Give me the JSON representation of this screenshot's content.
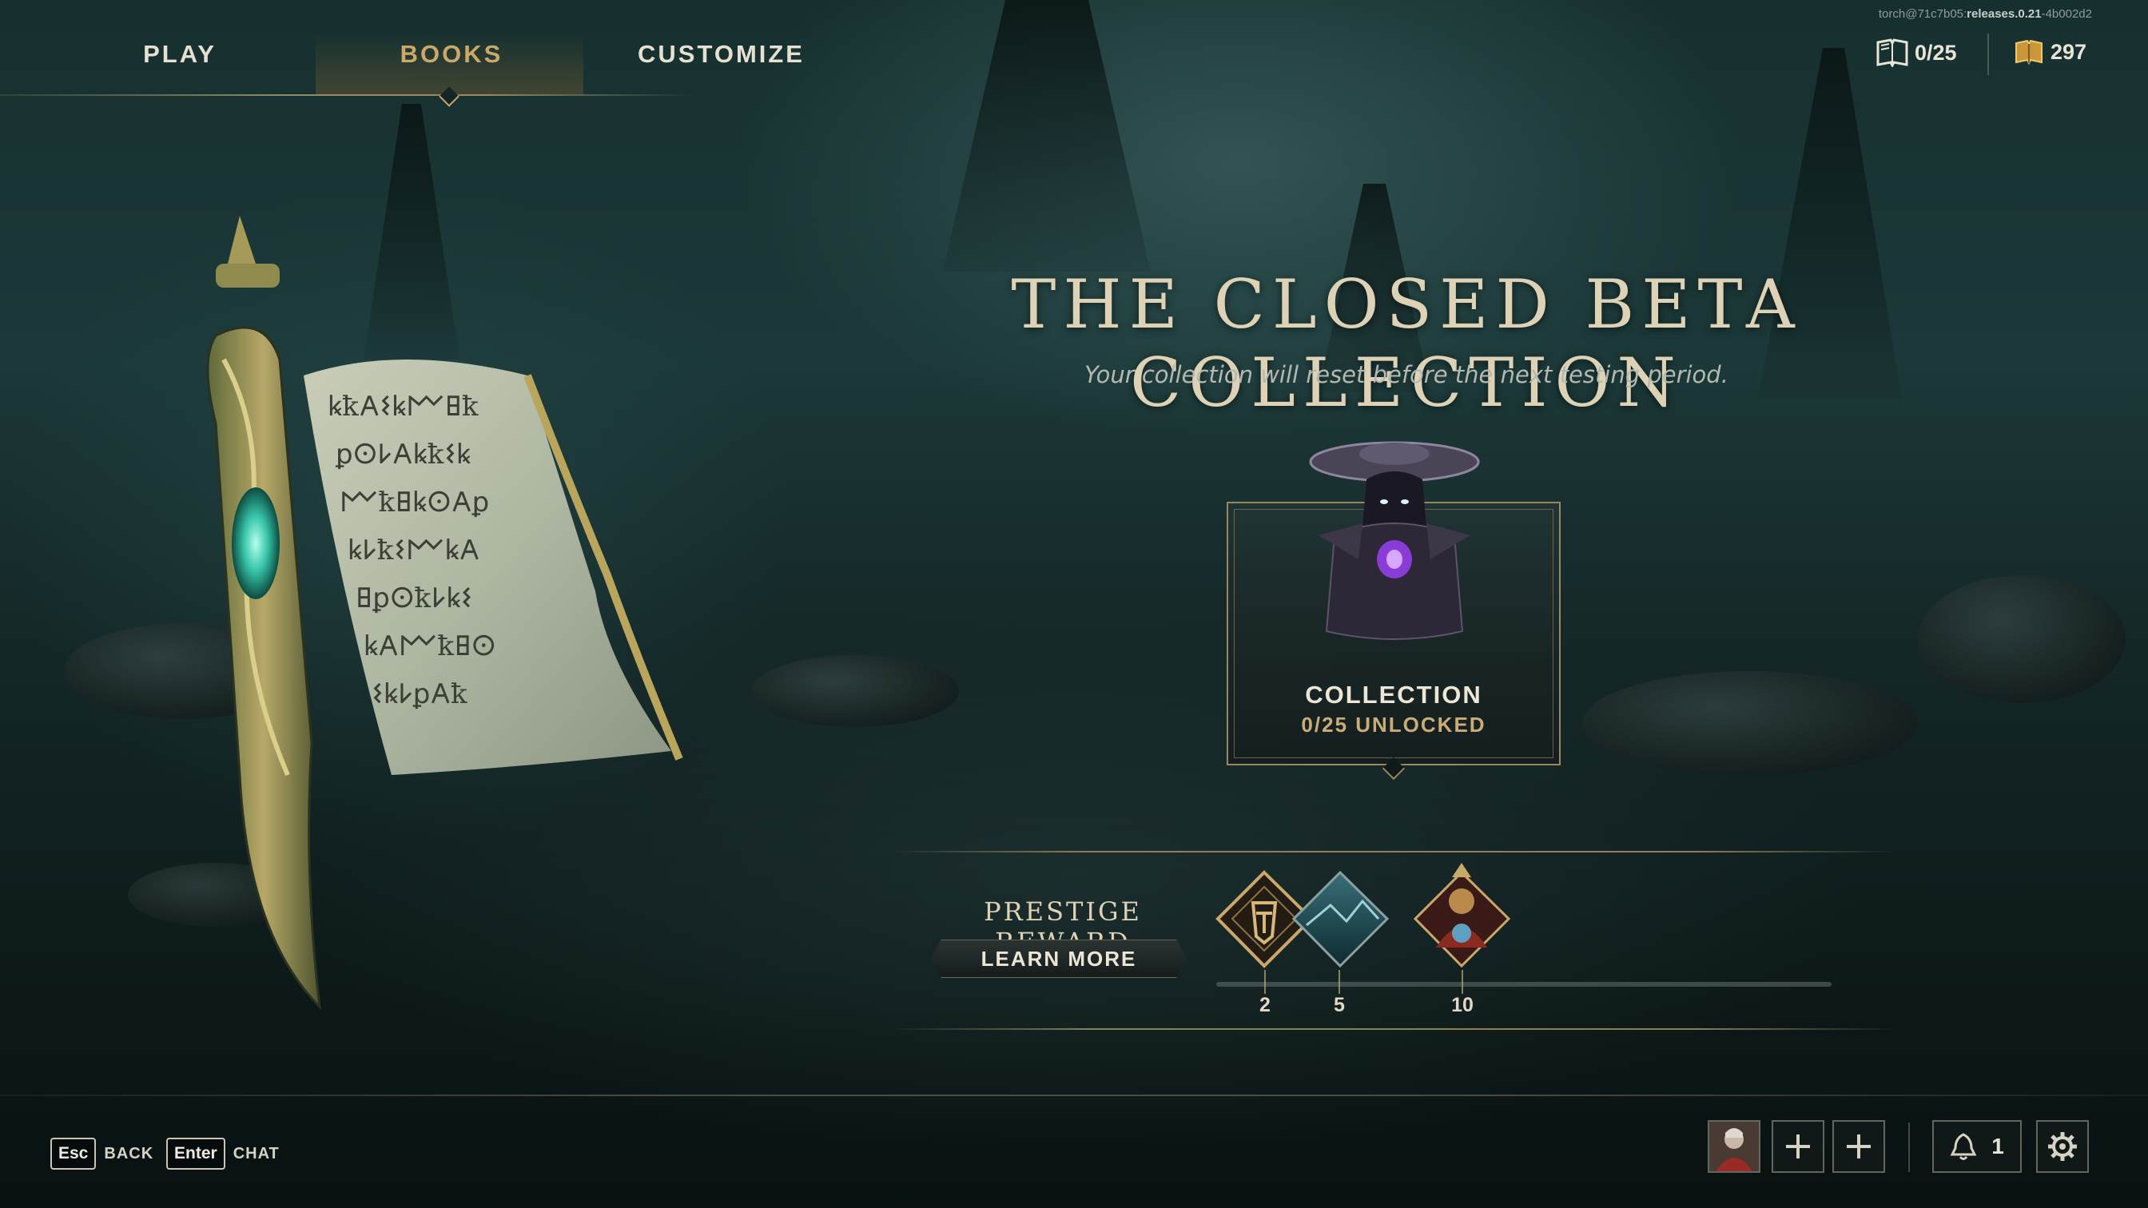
{
  "build": {
    "prefix": "torch@71c7b05:",
    "release": "releases.0.21",
    "suffix": "-4b002d2"
  },
  "nav": {
    "tabs": [
      {
        "label": "PLAY",
        "active": false
      },
      {
        "label": "BOOKS",
        "active": true
      },
      {
        "label": "CUSTOMIZE",
        "active": false
      }
    ]
  },
  "currency": {
    "books": {
      "icon": "book-icon",
      "value": "0/25"
    },
    "gold": {
      "icon": "gold-icon",
      "value": "297"
    }
  },
  "main": {
    "title": "THE CLOSED BETA COLLECTION",
    "subtitle": "Your collection will reset before the next testing period."
  },
  "collection_card": {
    "title": "COLLECTION",
    "status": "0/25 UNLOCKED"
  },
  "prestige": {
    "label": "PRESTIGE REWARD",
    "button": "LEARN MORE",
    "tiers": [
      {
        "value": "2",
        "icon": "emblem-icon"
      },
      {
        "value": "5",
        "icon": "landscape-banner-icon"
      },
      {
        "value": "10",
        "icon": "character-portrait-icon"
      }
    ]
  },
  "bottom": {
    "hints": [
      {
        "key": "Esc",
        "label": "BACK"
      },
      {
        "key": "Enter",
        "label": "CHAT"
      }
    ],
    "notifications": "1"
  },
  "colors": {
    "accent_gold": "#c9a86a",
    "text_light": "#ece6d6",
    "frame": "#9a8760"
  }
}
